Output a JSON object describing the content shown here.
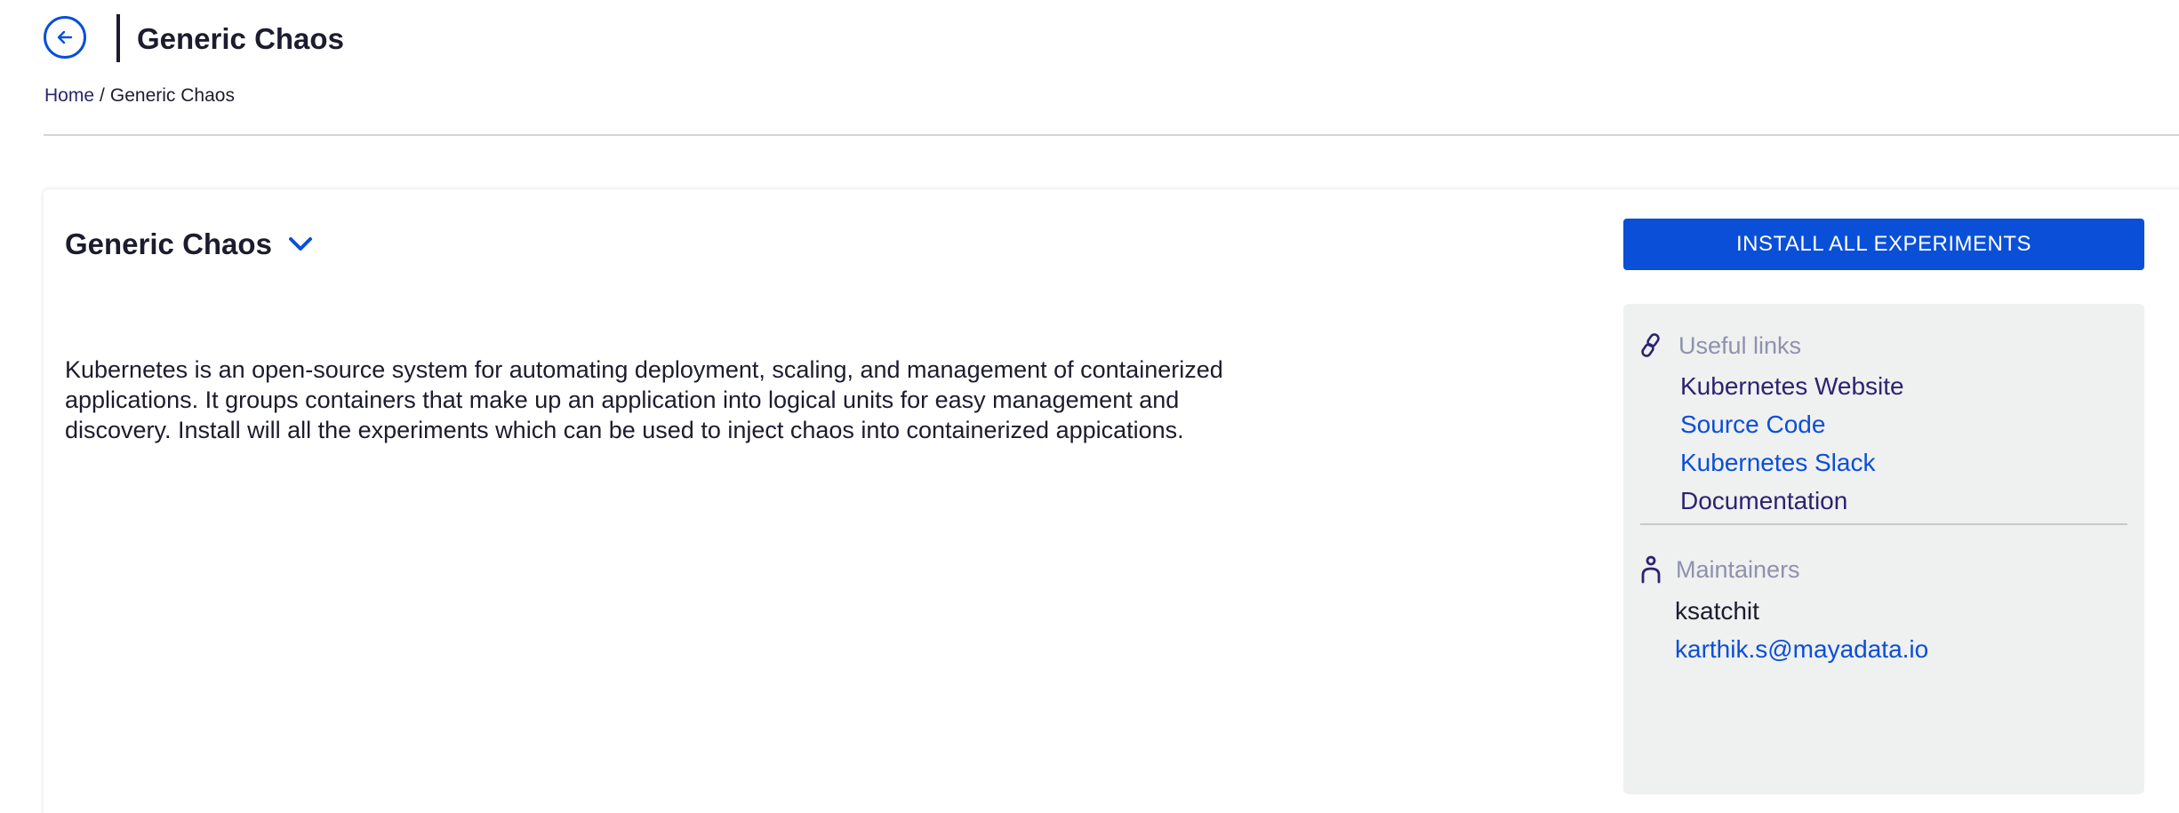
{
  "header": {
    "title": "Generic Chaos",
    "back_icon": "arrow-left-icon"
  },
  "breadcrumb": {
    "home": "Home",
    "separator": "/",
    "current": "Generic Chaos"
  },
  "card": {
    "heading": "Generic Chaos",
    "expand_icon": "chevron-down-icon",
    "description": "Kubernetes is an open-source system for automating deployment, scaling, and management of containerized applications. It groups containers that make up an application into logical units for easy management and discovery. Install will all the experiments which can be used to inject chaos into containerized appications."
  },
  "actions": {
    "install_all_label": "INSTALL ALL EXPERIMENTS"
  },
  "side_panel": {
    "useful_links": {
      "icon": "link-icon",
      "title": "Useful links",
      "links": [
        {
          "label": "Kubernetes Website"
        },
        {
          "label": "Source Code"
        },
        {
          "label": "Kubernetes Slack"
        },
        {
          "label": "Documentation"
        }
      ]
    },
    "maintainers": {
      "icon": "person-icon",
      "title": "Maintainers",
      "name": "ksatchit",
      "email": "karthik.s@mayadata.io"
    }
  },
  "colors": {
    "accent": "#0a4fd8",
    "dark_text": "#1c1c2e",
    "muted_text": "#8d92ad",
    "panel_bg": "#eff0f0"
  }
}
